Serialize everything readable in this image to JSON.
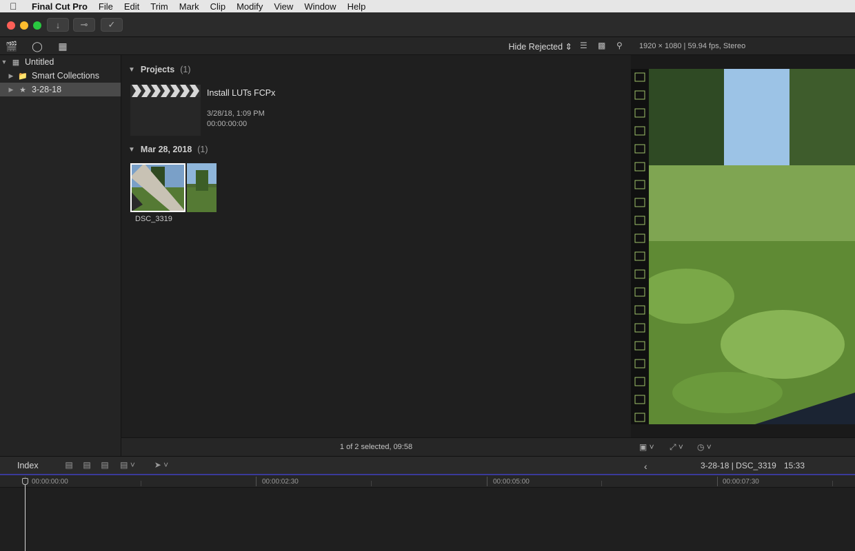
{
  "menubar": {
    "apple_icon": "apple-icon",
    "app_name": "Final Cut Pro",
    "items": [
      "File",
      "Edit",
      "Trim",
      "Mark",
      "Clip",
      "Modify",
      "View",
      "Window",
      "Help"
    ]
  },
  "toolbar": {
    "buttons": [
      "import-icon",
      "key-icon",
      "checkmark-icon"
    ]
  },
  "browser_header": {
    "filter_label": "Hide Rejected",
    "viewer_info": "1920 × 1080 | 59.94 fps, Stereo"
  },
  "sidebar": {
    "library": "Untitled",
    "smart_collections": "Smart Collections",
    "event": "3-28-18"
  },
  "browser": {
    "projects_header": "Projects",
    "projects_count": "(1)",
    "project_title": "Install LUTs FCPx",
    "project_date": "3/28/18, 1:09 PM",
    "project_duration": "00:00:00:00",
    "date_header": "Mar 28, 2018",
    "date_count": "(1)",
    "clip_name": "DSC_3319",
    "status": "1 of 2 selected, 09:58"
  },
  "timeline": {
    "index_label": "Index",
    "event_clip": "3-28-18 | DSC_3319",
    "duration": "15:33",
    "ruler": [
      "00:00:00:00",
      "00:00:02:30",
      "00:00:05:00",
      "00:00:07:30"
    ]
  },
  "colors": {
    "accent_blue": "#3a3a9a",
    "selection": "#4a4a4a"
  }
}
